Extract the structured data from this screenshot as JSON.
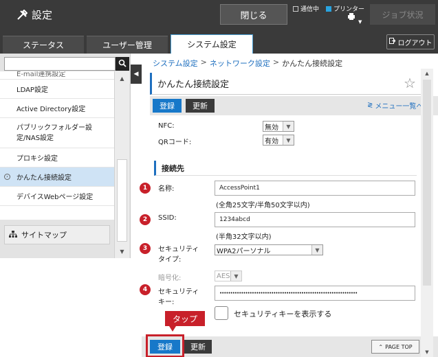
{
  "header": {
    "title": "設定",
    "close_label": "閉じる",
    "status_comm": "通信中",
    "status_printer": "プリンター",
    "job_status": "ジョブ状況"
  },
  "tabs": [
    {
      "label": "ステータス"
    },
    {
      "label": "ユーザー管理"
    },
    {
      "label": "システム設定",
      "active": true
    }
  ],
  "logout_label": "ログアウト",
  "sidebar": {
    "items": [
      {
        "label": "E-mail連携設定"
      },
      {
        "label": "LDAP設定"
      },
      {
        "label": "Active Directory設定"
      },
      {
        "label": "パブリックフォルダー設定/NAS設定"
      },
      {
        "label": "プロキシ設定"
      },
      {
        "label": "かんたん接続設定",
        "selected": true
      },
      {
        "label": "デバイスWebページ設定"
      }
    ],
    "sitemap_label": "サイトマップ"
  },
  "breadcrumb": {
    "items": [
      "システム設定",
      "ネットワーク設定"
    ],
    "current": "かんたん接続設定"
  },
  "page_title": "かんたん接続設定",
  "buttons": {
    "register": "登録",
    "update": "更新",
    "menu_list": "メニュー一覧へ",
    "page_top": "PAGE TOP"
  },
  "nfc": {
    "label": "NFC:",
    "value": "無効"
  },
  "qr": {
    "label": "QRコード:",
    "value": "有効"
  },
  "section_title": "接続先",
  "fields": {
    "name": {
      "num": "1",
      "label": "名称:",
      "value": "AccessPoint1",
      "hint": "(全角25文字/半角50文字以内)"
    },
    "ssid": {
      "num": "2",
      "label": "SSID:",
      "value": "1234abcd",
      "hint": "(半角32文字以内)"
    },
    "security_type": {
      "num": "3",
      "label_line1": "セキュリティ",
      "label_line2": "タイプ:",
      "value": "WPA2パーソナル"
    },
    "encryption": {
      "label": "暗号化:",
      "value": "AES"
    },
    "security_key": {
      "num": "4",
      "label_line1": "セキュリティ",
      "label_line2": "キー:",
      "value": "••••••••••••••••••••••••••••••••••••••••••••••••••••••••••••••••"
    },
    "show_key": {
      "label": "セキュリティキーを表示する"
    }
  },
  "callout": "タップ",
  "colors": {
    "accent": "#1778c9",
    "badge": "#c8202a",
    "topbar": "#3a3a3a"
  }
}
